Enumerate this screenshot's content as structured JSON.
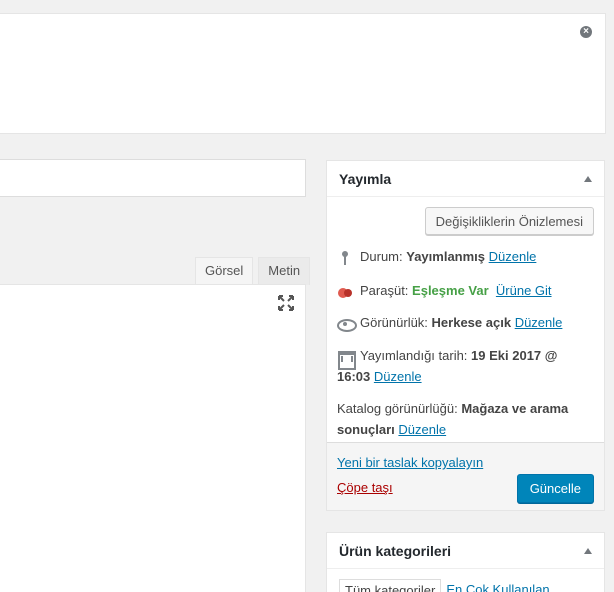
{
  "notice": {
    "close_icon": "close-icon"
  },
  "editor": {
    "tabs": [
      {
        "label": "Görsel",
        "active": true
      },
      {
        "label": "Metin",
        "active": false
      }
    ],
    "fullscreen_icon": "fullscreen-icon"
  },
  "publish": {
    "title": "Yayımla",
    "preview_button": "Değişikliklerin Önizlemesi",
    "status": {
      "label": "Durum:",
      "value": "Yayımlanmış",
      "edit": "Düzenle"
    },
    "parasut": {
      "label": "Paraşüt:",
      "value": "Eşleşme Var",
      "link": "Ürüne Git"
    },
    "visibility": {
      "label": "Görünürlük:",
      "value": "Herkese açık",
      "edit": "Düzenle"
    },
    "published": {
      "label": "Yayımlandığı tarih:",
      "value_line1": "19 Eki 2017 @",
      "value_line2": "16:03",
      "edit": "Düzenle"
    },
    "catalog": {
      "label": "Katalog görünürlüğü:",
      "value_line1": "Mağaza ve arama",
      "value_line2": "sonuçları",
      "edit": "Düzenle"
    },
    "copy_link": "Yeni bir taslak kopyalayın",
    "trash_link": "Çöpe taşı",
    "update_button": "Güncelle"
  },
  "categories": {
    "title": "Ürün kategorileri",
    "tabs": [
      {
        "label": "Tüm kategoriler",
        "active": true
      },
      {
        "label": "En Çok Kullanılan",
        "active": false
      }
    ]
  },
  "colors": {
    "accent": "#0085ba",
    "link": "#0073aa",
    "trash": "#a00",
    "ok": "#46a046"
  }
}
